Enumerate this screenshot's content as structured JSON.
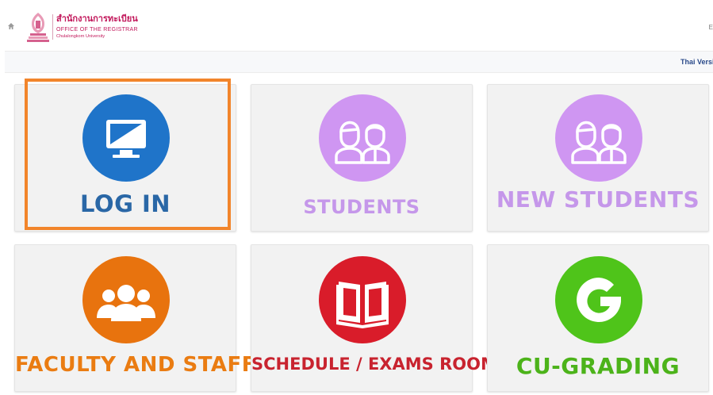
{
  "header": {
    "home_icon": "home-icon",
    "logo_icon": "chula-emblem-icon",
    "org_name_th": "สำนักงานการทะเบียน",
    "org_name_en": "OFFICE OF THE REGISTRAR",
    "university": "Chulalongkorn University",
    "top_right_text": "E"
  },
  "language_bar": {
    "link_label": "Thai Version"
  },
  "tiles": [
    {
      "label": "LOG IN",
      "icon": "monitor-icon",
      "circle_color": "#1f74c9",
      "label_color": "#2a67a6"
    },
    {
      "label": "STUDENTS",
      "icon": "students-icon",
      "circle_color": "#cf96f2",
      "label_color": "#c597ea"
    },
    {
      "label": "NEW STUDENTS",
      "icon": "students-icon",
      "circle_color": "#cf96f2",
      "label_color": "#c597ea"
    },
    {
      "label": "FACULTY AND STAFF",
      "icon": "people-group-icon",
      "circle_color": "#e8730e",
      "label_color": "#ea7c12"
    },
    {
      "label": "SCHEDULE / EXAMS ROOM",
      "icon": "book-icon",
      "circle_color": "#d91c2a",
      "label_color": "#c8232f"
    },
    {
      "label": "CU-GRADING",
      "icon": "grading-g-icon",
      "circle_color": "#4fc41a",
      "label_color": "#4cb31a"
    }
  ],
  "highlight_color": "#f2852b"
}
